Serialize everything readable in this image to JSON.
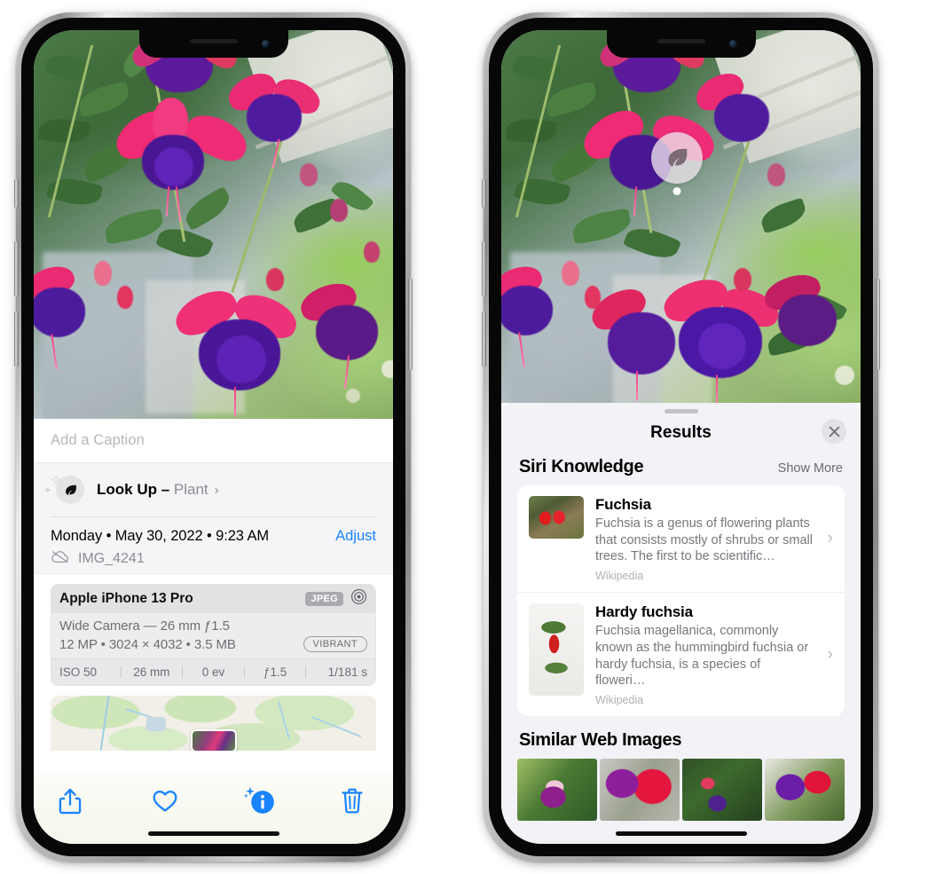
{
  "left_phone": {
    "caption": {
      "placeholder": "Add a Caption",
      "value": ""
    },
    "lookup": {
      "label": "Look Up –",
      "subject": "Plant",
      "chevron": "›",
      "icon": "leaf-icon"
    },
    "metadata": {
      "date": "Monday • May 30, 2022 • 9:23 AM",
      "adjust_label": "Adjust",
      "filename": "IMG_4241",
      "cloud_icon": "icloud-slash-icon"
    },
    "camera_card": {
      "device": "Apple iPhone 13 Pro",
      "format_tag": "JPEG",
      "raw_icon": "aperture-icon",
      "lens": "Wide Camera — 26 mm ƒ1.5",
      "specs": "12 MP • 3024 × 4032 • 3.5 MB",
      "style_tag": "VIBRANT",
      "exif": [
        "ISO 50",
        "26 mm",
        "0 ev",
        "ƒ1.5",
        "1/181 s"
      ]
    },
    "toolbar": [
      {
        "name": "share-button",
        "icon": "share-icon"
      },
      {
        "name": "favorite-button",
        "icon": "heart-icon"
      },
      {
        "name": "info-button",
        "icon": "info-sparkle-icon"
      },
      {
        "name": "delete-button",
        "icon": "trash-icon"
      }
    ],
    "accent_color": "#1a84ff"
  },
  "right_phone": {
    "visual_lookup_pin": {
      "icon": "leaf-icon"
    },
    "sheet": {
      "title": "Results",
      "close_icon": "close-icon",
      "sections": [
        {
          "title": "Siri Knowledge",
          "action": "Show More",
          "items": [
            {
              "title": "Fuchsia",
              "description": "Fuchsia is a genus of flowering plants that consists mostly of shrubs or small trees. The first to be scientific…",
              "source": "Wikipedia",
              "chevron": "›"
            },
            {
              "title": "Hardy fuchsia",
              "description": "Fuchsia magellanica, commonly known as the hummingbird fuchsia or hardy fuchsia, is a species of floweri…",
              "source": "Wikipedia",
              "chevron": "›"
            }
          ]
        },
        {
          "title": "Similar Web Images",
          "thumbnails": [
            "fuchsia-pink-white",
            "fuchsia-red-closeup",
            "fuchsia-bush",
            "fuchsia-purple-red"
          ]
        }
      ]
    }
  }
}
